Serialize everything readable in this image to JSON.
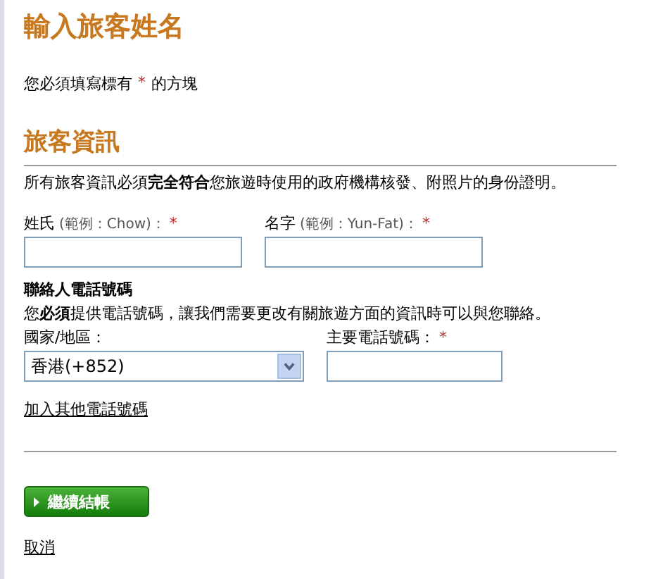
{
  "title": "輸入旅客姓名",
  "required_note": {
    "before": "您必須填寫標有",
    "mark": "*",
    "after": "的方塊"
  },
  "section": {
    "heading": "旅客資訊",
    "instruction": "所有旅客資訊必須**完全符合**您旅遊時使用的政府機構核發、附照片的身份證明。"
  },
  "name_fields": [
    {
      "label": "姓氏",
      "hint": "(範例：Chow)：",
      "required": true,
      "mark": "*"
    },
    {
      "label": "名字",
      "hint": "(範例：Yun-Fat)：",
      "required": true,
      "mark": "*"
    }
  ],
  "contact": {
    "heading": "聯絡人電話號碼",
    "instruction": "您**必須**提供電話號碼，讓我們需要更改有關旅遊方面的資訊時可以與您聯絡。",
    "country_label": "國家/地區：",
    "country_value": "香港(+852)",
    "phone_label": "主要電話號碼：",
    "phone_required": true,
    "phone_mark": "*"
  },
  "add_phone_link": "加入其他電話號碼",
  "continue_button": "繼續結帳",
  "cancel_link": "取消"
}
